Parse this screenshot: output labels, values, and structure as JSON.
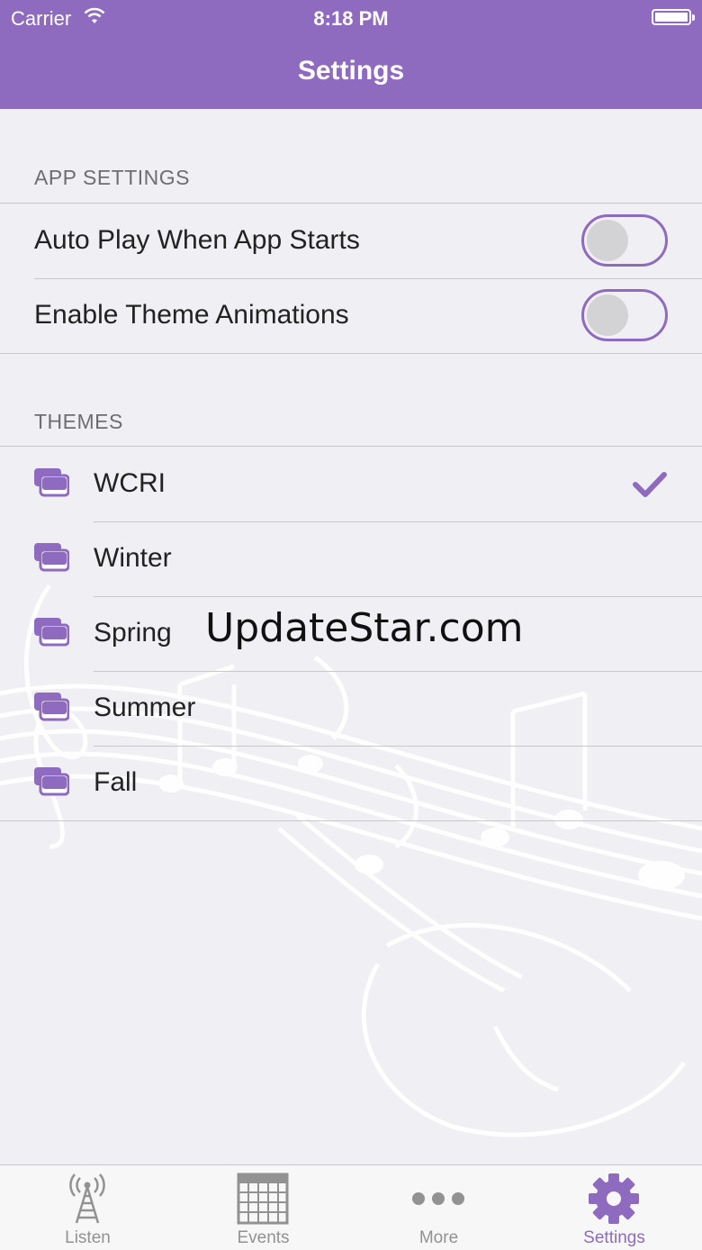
{
  "status_bar": {
    "carrier": "Carrier",
    "time": "8:18 PM"
  },
  "nav": {
    "title": "Settings"
  },
  "app_settings": {
    "header": "APP SETTINGS",
    "items": [
      {
        "label": "Auto Play When App Starts",
        "on": false
      },
      {
        "label": "Enable Theme Animations",
        "on": false
      }
    ]
  },
  "themes": {
    "header": "THEMES",
    "selected": "WCRI",
    "items": [
      {
        "label": "WCRI"
      },
      {
        "label": "Winter"
      },
      {
        "label": "Spring"
      },
      {
        "label": "Summer"
      },
      {
        "label": "Fall"
      }
    ]
  },
  "watermark": "UpdateStar.com",
  "tabbar": {
    "items": [
      {
        "label": "Listen",
        "icon": "radio-tower-icon"
      },
      {
        "label": "Events",
        "icon": "calendar-grid-icon"
      },
      {
        "label": "More",
        "icon": "more-dots-icon"
      },
      {
        "label": "Settings",
        "icon": "gear-icon"
      }
    ],
    "active": "Settings"
  },
  "colors": {
    "accent": "#8e6bbf",
    "background": "#efeff4",
    "separator": "#c8c7cc"
  }
}
